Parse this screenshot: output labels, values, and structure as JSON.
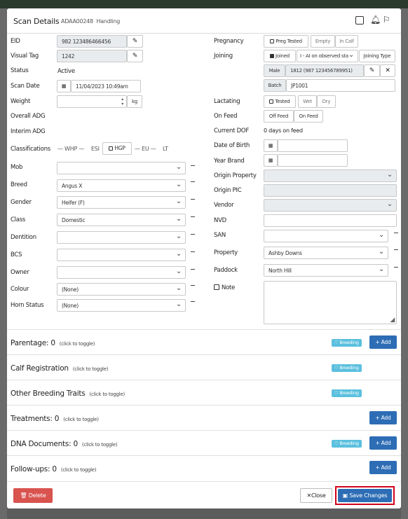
{
  "header": {
    "title": "Scan Details",
    "animal_id": "ADAA00248",
    "mode": "Handling"
  },
  "left": {
    "eid_label": "EID",
    "eid_value": "982 123486466456",
    "visual_tag_label": "Visual Tag",
    "visual_tag_value": "1242",
    "status_label": "Status",
    "status_value": "Active",
    "scan_date_label": "Scan Date",
    "scan_date_value": "11/04/2023 10:49am",
    "weight_label": "Weight",
    "weight_unit": "kg",
    "overall_adg_label": "Overall ADG",
    "interim_adg_label": "Interim ADG",
    "classifications_label": "Classifications",
    "class_items": [
      "WHP",
      "ESI",
      "HGP",
      "EU",
      "LT"
    ],
    "mob_label": "Mob",
    "breed_label": "Breed",
    "breed_value": "Angus X",
    "gender_label": "Gender",
    "gender_value": "Heifer (F)",
    "class_label": "Class",
    "class_value": "Domestic",
    "dentition_label": "Dentition",
    "bcs_label": "BCS",
    "owner_label": "Owner",
    "colour_label": "Colour",
    "colour_value": "(None)",
    "horn_label": "Horn Status",
    "horn_value": "(None)"
  },
  "right": {
    "pregnancy_label": "Pregnancy",
    "preg_tested": "Preg Tested",
    "empty": "Empty",
    "in_calf": "In Calf",
    "joining_label": "Joining",
    "joined": "Joined",
    "joining_method": "I - AI on observed sta",
    "joining_type": "Joining Type",
    "sire_sex": "Male",
    "sire_value": "1812 (987 123456789951)",
    "batch_label": "Batch",
    "batch_value": "JP1001",
    "lactating_label": "Lactating",
    "tested": "Tested",
    "wet": "Wet",
    "dry": "Dry",
    "on_feed_label": "On Feed",
    "off_feed": "Off Feed",
    "on_feed_btn": "On Feed",
    "current_dof_label": "Current DOF",
    "current_dof_value": "0 days on feed",
    "dob_label": "Date of Birth",
    "year_brand_label": "Year Brand",
    "origin_property_label": "Origin Property",
    "origin_pic_label": "Origin PIC",
    "vendor_label": "Vendor",
    "nvd_label": "NVD",
    "san_label": "SAN",
    "property_label": "Property",
    "property_value": "Ashby Downs",
    "paddock_label": "Paddock",
    "paddock_value": "North Hill",
    "note_label": "Note"
  },
  "sections": [
    {
      "title": "Parentage:",
      "count": "0",
      "hint": "(click to toggle)",
      "badge": "Breeding",
      "add": "+ Add"
    },
    {
      "title": "Calf Registration",
      "count": "",
      "hint": "(click to toggle)",
      "badge": "Breeding",
      "add": ""
    },
    {
      "title": "Other Breeding Traits",
      "count": "",
      "hint": "(click to toggle)",
      "badge": "Breeding",
      "add": ""
    },
    {
      "title": "Treatments:",
      "count": "0",
      "hint": "(click to toggle)",
      "badge": "",
      "add": "+ Add"
    },
    {
      "title": "DNA Documents:",
      "count": "0",
      "hint": "(click to toggle)",
      "badge": "Breeding",
      "add": "+ Add"
    },
    {
      "title": "Follow-ups:",
      "count": "0",
      "hint": "(click to toggle)",
      "badge": "",
      "add": "+ Add"
    }
  ],
  "footer": {
    "delete": "Delete",
    "close": "Close",
    "save": "Save Changes"
  },
  "colors": {
    "primary": "#2d6db5",
    "danger": "#d9534f",
    "info": "#5bc0de",
    "highlight": "#d0021b"
  }
}
